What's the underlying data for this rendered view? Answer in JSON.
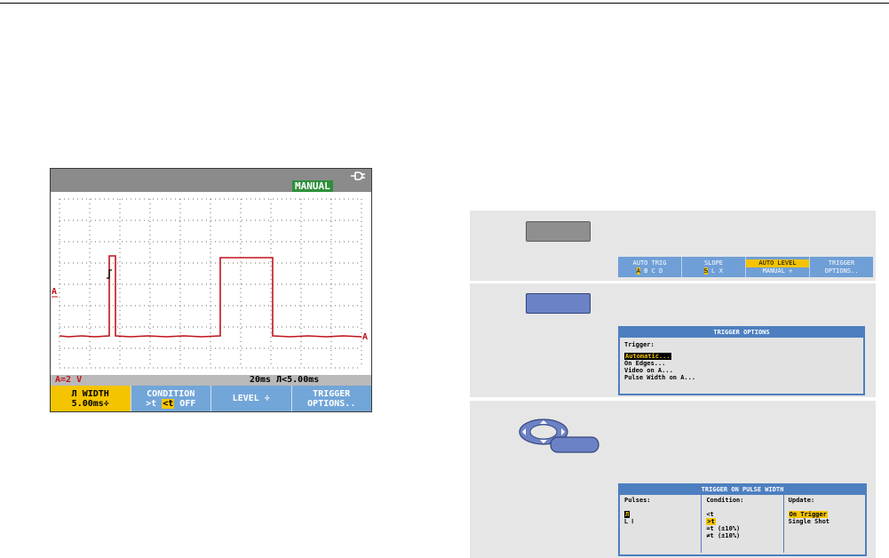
{
  "scope": {
    "header_badge": "MANUAL",
    "channel_marker": "A",
    "trace_end_marker": "A",
    "status_left": "A=2 V",
    "status_right": "20ms Л<5.00ms",
    "softkeys": [
      {
        "line1": "Л WIDTH",
        "line2": "5.00ms÷"
      },
      {
        "line1": "CONDITION",
        "line2_a": ">t",
        "line2_sel": "<t",
        "line2_b": "OFF"
      },
      {
        "line1": "LEVEL ÷"
      },
      {
        "line1": "TRIGGER",
        "line2": "OPTIONS.."
      }
    ]
  },
  "step1": {
    "menu": [
      {
        "l1": "AUTO TRIG",
        "l2_sel": "A",
        "l2": " B  C  D"
      },
      {
        "l1": "SLOPE",
        "l2_sel": "Ꭶ",
        "l2": " Ꮮ  Ⅹ"
      },
      {
        "l1_sel": "AUTO LEVEL",
        "l2": "MANUAL ÷"
      },
      {
        "l1": "TRIGGER",
        "l2": "OPTIONS.."
      }
    ]
  },
  "step2": {
    "dialog_title": "TRIGGER OPTIONS",
    "label": "Trigger:",
    "selected": "Automatic...",
    "options": [
      "On Edges...",
      "Video on A...",
      "Pulse Width on A..."
    ]
  },
  "step3": {
    "dialog_title": "TRIGGER ON PULSE WIDTH",
    "pulses_header": "Pulses:",
    "pulses_selected": "Л",
    "pulses_other": "Ⅼ Ⅰ",
    "condition_header": "Condition:",
    "condition_opt1": "<t",
    "condition_selected": ">t",
    "condition_opts": [
      "=t (±10%)",
      "≠t (±10%)"
    ],
    "update_header": "Update:",
    "update_selected": "On Trigger",
    "update_other": "Single Shot"
  },
  "colors": {
    "trace": "#c0141c",
    "softkey_active": "#f4c400",
    "softkey": "#72a5d8",
    "dialog_border": "#4d7fc0"
  }
}
